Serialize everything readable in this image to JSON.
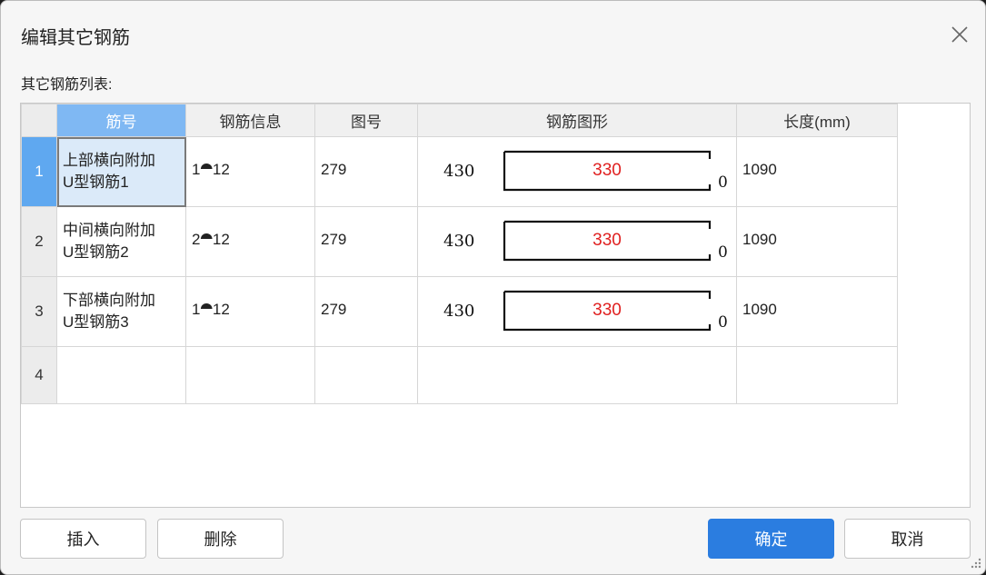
{
  "dialog": {
    "title": "编辑其它钢筋",
    "list_label": "其它钢筋列表:"
  },
  "table": {
    "columns": [
      "",
      "筋号",
      "钢筋信息",
      "图号",
      "钢筋图形",
      "长度(mm)"
    ],
    "rows": [
      {
        "num": "1",
        "name_line1": "上部横向附加",
        "name_line2": "U型钢筋1",
        "info": "1⯊12",
        "code": "279",
        "shape_left": "430",
        "shape_mid": "330",
        "shape_right": "0",
        "length": "1090"
      },
      {
        "num": "2",
        "name_line1": "中间横向附加",
        "name_line2": "U型钢筋2",
        "info": "2⯊12",
        "code": "279",
        "shape_left": "430",
        "shape_mid": "330",
        "shape_right": "0",
        "length": "1090"
      },
      {
        "num": "3",
        "name_line1": "下部横向附加",
        "name_line2": "U型钢筋3",
        "info": "1⯊12",
        "code": "279",
        "shape_left": "430",
        "shape_mid": "330",
        "shape_right": "0",
        "length": "1090"
      },
      {
        "num": "4",
        "name_line1": "",
        "name_line2": "",
        "info": "",
        "code": "",
        "shape_left": "",
        "shape_mid": "",
        "shape_right": "",
        "length": ""
      }
    ]
  },
  "buttons": {
    "insert": "插入",
    "delete": "删除",
    "ok": "确定",
    "cancel": "取消"
  },
  "icons": {
    "close": "close-icon",
    "resize": "resize-grip-icon"
  },
  "colors": {
    "primary": "#2b7de0",
    "header_active": "#7fb8f3",
    "shape_value": "#e02020"
  }
}
